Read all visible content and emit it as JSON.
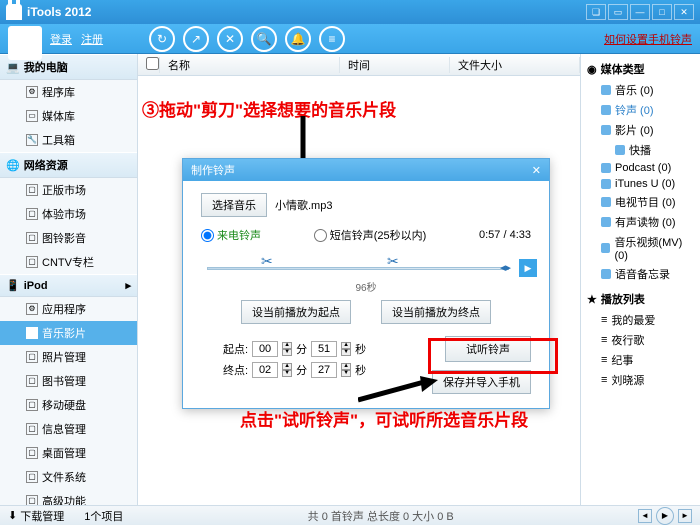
{
  "title": "iTools 2012",
  "userbar": {
    "login": "登录",
    "register": "注册",
    "helplink": "如何设置手机铃声"
  },
  "sidebar": {
    "sections": [
      {
        "title": "我的电脑",
        "items": [
          "程序库",
          "媒体库",
          "工具箱"
        ]
      },
      {
        "title": "网络资源",
        "items": [
          "正版市场",
          "体验市场",
          "图铃影音",
          "CNTV专栏"
        ]
      },
      {
        "title": "iPod",
        "items": [
          "应用程序",
          "音乐影片",
          "照片管理",
          "图书管理",
          "移动硬盘",
          "信息管理",
          "桌面管理",
          "文件系统",
          "高级功能"
        ],
        "selected": 1
      }
    ]
  },
  "listhdr": {
    "chk": "",
    "name": "名称",
    "time": "时间",
    "size": "文件大小"
  },
  "rightbar": {
    "media_hdr": "媒体类型",
    "media": [
      {
        "label": "音乐 (0)"
      },
      {
        "label": "铃声 (0)",
        "active": true
      },
      {
        "label": "影片 (0)",
        "sub": "快播"
      },
      {
        "label": "Podcast (0)"
      },
      {
        "label": "iTunes U (0)"
      },
      {
        "label": "电视节目 (0)"
      },
      {
        "label": "有声读物 (0)"
      },
      {
        "label": "音乐视频(MV) (0)"
      },
      {
        "label": "语音备忘录"
      }
    ],
    "playlist_hdr": "播放列表",
    "playlists": [
      "我的最爱",
      "夜行歌",
      "纪事",
      "刘晓源"
    ]
  },
  "dialog": {
    "title": "制作铃声",
    "choose_btn": "选择音乐",
    "filename": "小情歌.mp3",
    "radio1": "来电铃声",
    "radio2": "短信铃声(25秒以内)",
    "time": "0:57 / 4:33",
    "seg": "96秒",
    "set_start": "设当前播放为起点",
    "set_end": "设当前播放为终点",
    "start_label": "起点:",
    "end_label": "终点:",
    "min": "分",
    "sec": "秒",
    "start_m": "00",
    "start_s": "51",
    "end_m": "02",
    "end_s": "27",
    "listen": "试听铃声",
    "save": "保存并导入手机"
  },
  "anno": {
    "top": "③拖动\"剪刀\"选择想要的音乐片段",
    "bottom": "点击\"试听铃声\"，可试听所选音乐片段"
  },
  "status": {
    "dl": "下载管理",
    "count": "1个项目",
    "summary": "共 0 首铃声  总长度 0  大小 0 B"
  }
}
